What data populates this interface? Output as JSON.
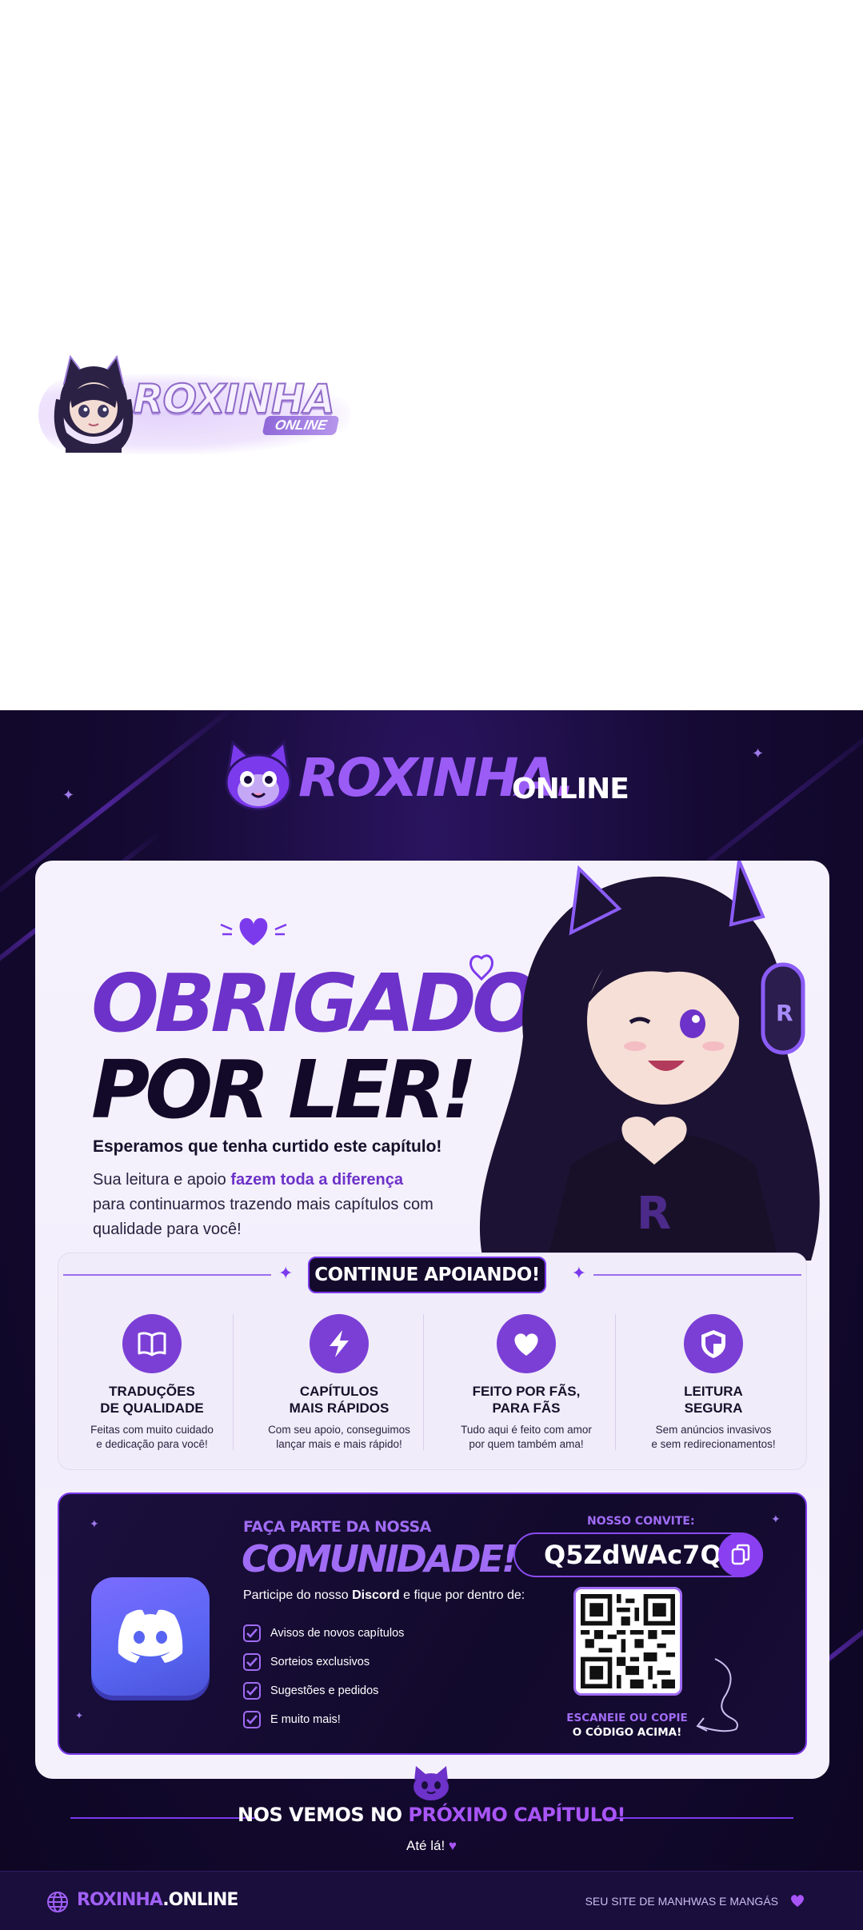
{
  "top_logo": {
    "text": "ROXINHA",
    "sub": "ONLINE"
  },
  "brand": {
    "name": "ROXINHA",
    "dot": ".",
    "suffix": "ONLINE"
  },
  "thanks": {
    "line1": "OBRIGADO",
    "line2": "POR LER!",
    "hope": "Esperamos que tenha curtido este capítulo!",
    "support_pre": "Sua leitura e apoio ",
    "support_highlight": "fazem toda a diferença",
    "support_post": "para continuarmos trazendo mais capítulos com qualidade para você!"
  },
  "continue_label": "CONTINUE APOIANDO!",
  "features": [
    {
      "icon": "book-icon",
      "title": "TRADUÇÕES\nDE QUALIDADE",
      "desc": "Feitas com muito cuidado\ne dedicação para você!"
    },
    {
      "icon": "lightning-icon",
      "title": "CAPÍTULOS\nMAIS RÁPIDOS",
      "desc": "Com seu apoio, conseguimos\nlançar mais e mais rápido!"
    },
    {
      "icon": "heart-icon",
      "title": "FEITO POR FÃS,\nPARA FÃS",
      "desc": "Tudo aqui é feito com amor\npor quem também ama!"
    },
    {
      "icon": "shield-icon",
      "title": "LEITURA\nSEGURA",
      "desc": "Sem anúncios invasivos\ne sem redirecionamentos!"
    }
  ],
  "community": {
    "pre": "FAÇA PARTE DA NOSSA",
    "title": "COMUNIDADE!",
    "invite_pre": "Participe do nosso ",
    "invite_bold": "Discord",
    "invite_post": " e fique por dentro de:",
    "bullets": [
      "Avisos de novos capítulos",
      "Sorteios exclusivos",
      "Sugestões e pedidos",
      "E muito mais!"
    ],
    "invite_label": "NOSSO CONVITE:",
    "invite_code": "Q5ZdWAc7Qr",
    "scan_line1": "ESCANEIE OU COPIE",
    "scan_line2": "O CÓDIGO ACIMA!"
  },
  "closing": {
    "see_pre": "NOS VEMOS NO ",
    "see_accent": "PRÓXIMO CAPÍTULO!",
    "bye": "Até lá!"
  },
  "footer": {
    "brand_main": "ROXINHA",
    "brand_suffix": ".ONLINE",
    "tagline": "SEU SITE DE MANHWAS E MANGÁS"
  },
  "colors": {
    "accent": "#7c3aed",
    "accent_light": "#a855f7",
    "dark_bg": "#150a33",
    "discord": "#5865f2"
  }
}
